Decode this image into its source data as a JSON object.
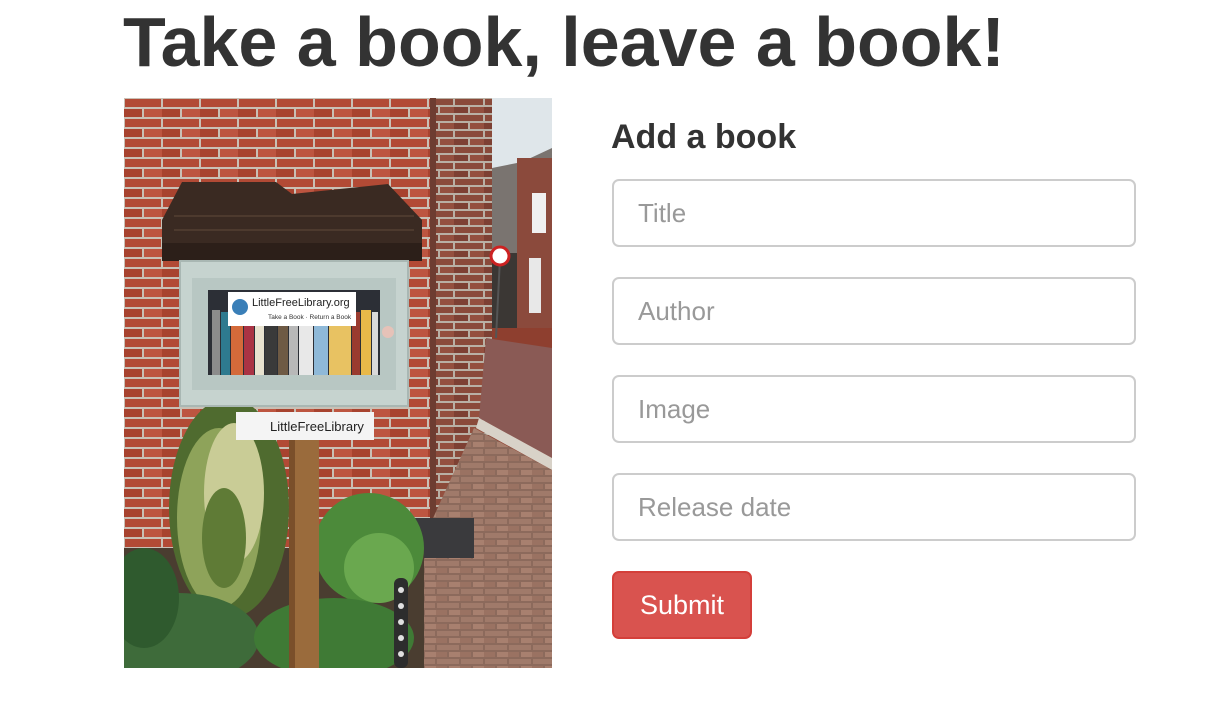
{
  "page": {
    "title": "Take a book, leave a book!"
  },
  "photo": {
    "sign_top_line1": "LittleFreeLibrary.org",
    "sign_top_line2": "Take a Book · Return a Book",
    "sign_bottom": "LittleFreeLibrary"
  },
  "form": {
    "heading": "Add a book",
    "title_placeholder": "Title",
    "author_placeholder": "Author",
    "image_placeholder": "Image",
    "release_date_placeholder": "Release date",
    "submit_label": "Submit"
  },
  "colors": {
    "submit_bg": "#d9534f",
    "submit_border": "#d43f3a",
    "input_border": "#cccccc",
    "text": "#333333"
  }
}
